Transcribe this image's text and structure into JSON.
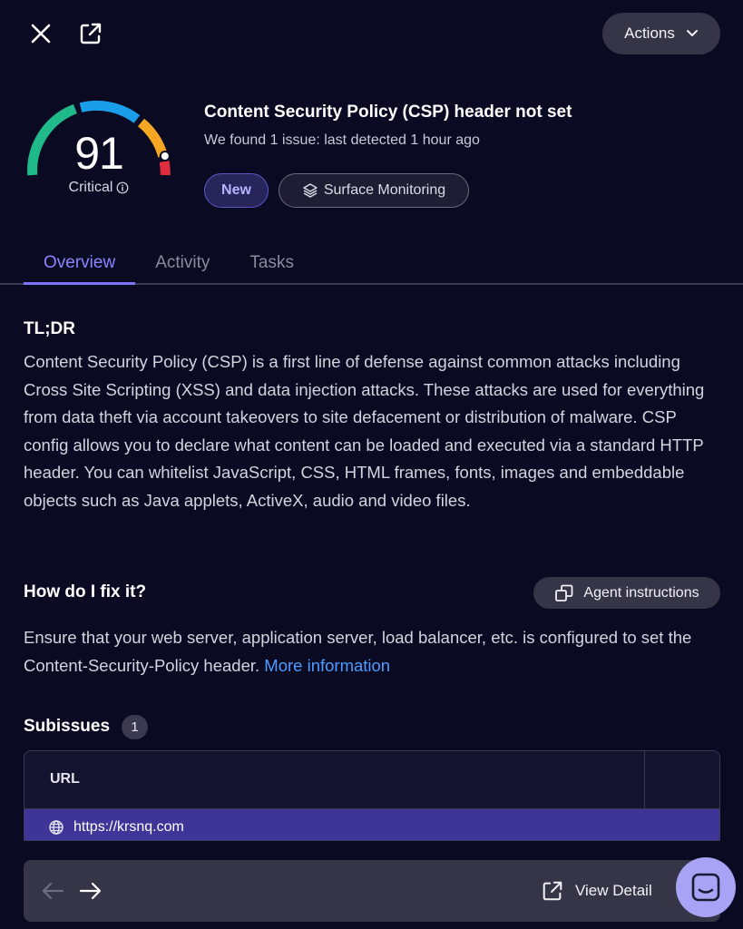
{
  "header": {
    "actions_label": "Actions"
  },
  "score": {
    "value": "91",
    "severity": "Critical",
    "colors": [
      "#1fb98a",
      "#1a9eea",
      "#f5a623",
      "#e02d3c"
    ]
  },
  "issue": {
    "title": "Content Security Policy (CSP) header not set",
    "subtitle": "We found 1 issue: last detected 1 hour ago"
  },
  "badges": {
    "status": "New",
    "source": "Surface Monitoring"
  },
  "tabs": [
    {
      "label": "Overview",
      "active": true
    },
    {
      "label": "Activity",
      "active": false
    },
    {
      "label": "Tasks",
      "active": false
    }
  ],
  "tldr": {
    "heading": "TL;DR",
    "text": "Content Security Policy (CSP) is a first line of defense against common attacks including Cross Site Scripting (XSS) and data injection attacks. These attacks are used for everything from data theft via account takeovers to site defacement or distribution of malware. CSP config allows you to declare what content can be loaded and executed via a standard HTTP header. You can whitelist JavaScript, CSS, HTML frames, fonts, images and embeddable objects such as Java applets, ActiveX, audio and video files."
  },
  "fix": {
    "heading": "How do I fix it?",
    "agent_button": "Agent instructions",
    "text": "Ensure that your web server, application server, load balancer, etc. is configured to set the Content-Security-Policy header.",
    "link": "More information"
  },
  "subissues": {
    "heading": "Subissues",
    "count": "1",
    "columns": [
      "URL"
    ],
    "rows": [
      {
        "url": "https://krsnq.com"
      }
    ]
  },
  "footer": {
    "view_detail": "View Detail"
  },
  "accent_color": "#7b75ff"
}
